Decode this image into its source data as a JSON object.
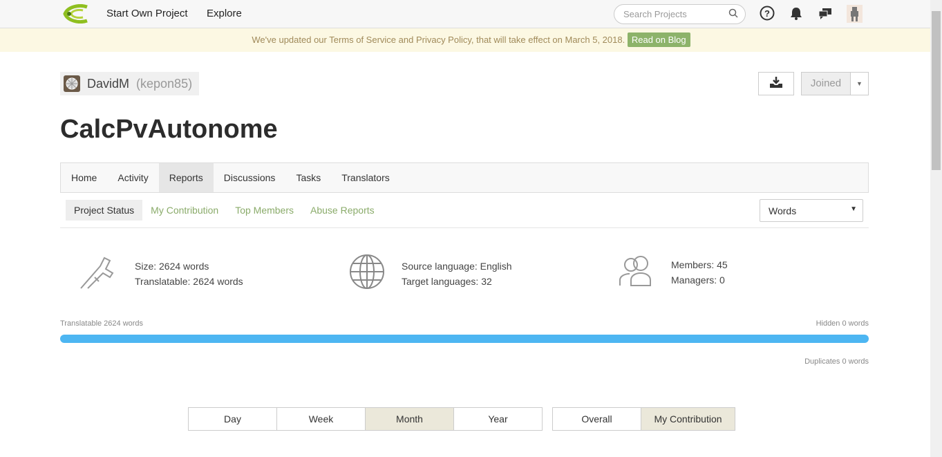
{
  "nav": {
    "start_project": "Start Own Project",
    "explore": "Explore",
    "search_placeholder": "Search Projects"
  },
  "banner": {
    "text": "We've updated our Terms of Service and Privacy Policy, that will take effect on March 5, 2018.",
    "link": "Read on Blog"
  },
  "owner": {
    "name": "DavidM",
    "handle": "(kepon85)"
  },
  "actions": {
    "joined": "Joined"
  },
  "project": {
    "title": "CalcPvAutonome"
  },
  "tabs": [
    "Home",
    "Activity",
    "Reports",
    "Discussions",
    "Tasks",
    "Translators"
  ],
  "subtabs": [
    "Project Status",
    "My Contribution",
    "Top Members",
    "Abuse Reports"
  ],
  "unit_select": "Words",
  "stats": {
    "size": "Size: 2624 words",
    "translatable": "Translatable: 2624 words",
    "source": "Source language: English",
    "targets": "Target languages: 32",
    "members": "Members: 45",
    "managers": "Managers: 0"
  },
  "progress": {
    "left": "Translatable 2624 words",
    "right": "Hidden 0 words",
    "duplicates": "Duplicates 0 words",
    "translatable_percent": 100
  },
  "periods": [
    "Day",
    "Week",
    "Month",
    "Year"
  ],
  "scope": [
    "Overall",
    "My Contribution"
  ],
  "colors": {
    "accent": "#8db36a",
    "bar": "#4db6f2"
  }
}
